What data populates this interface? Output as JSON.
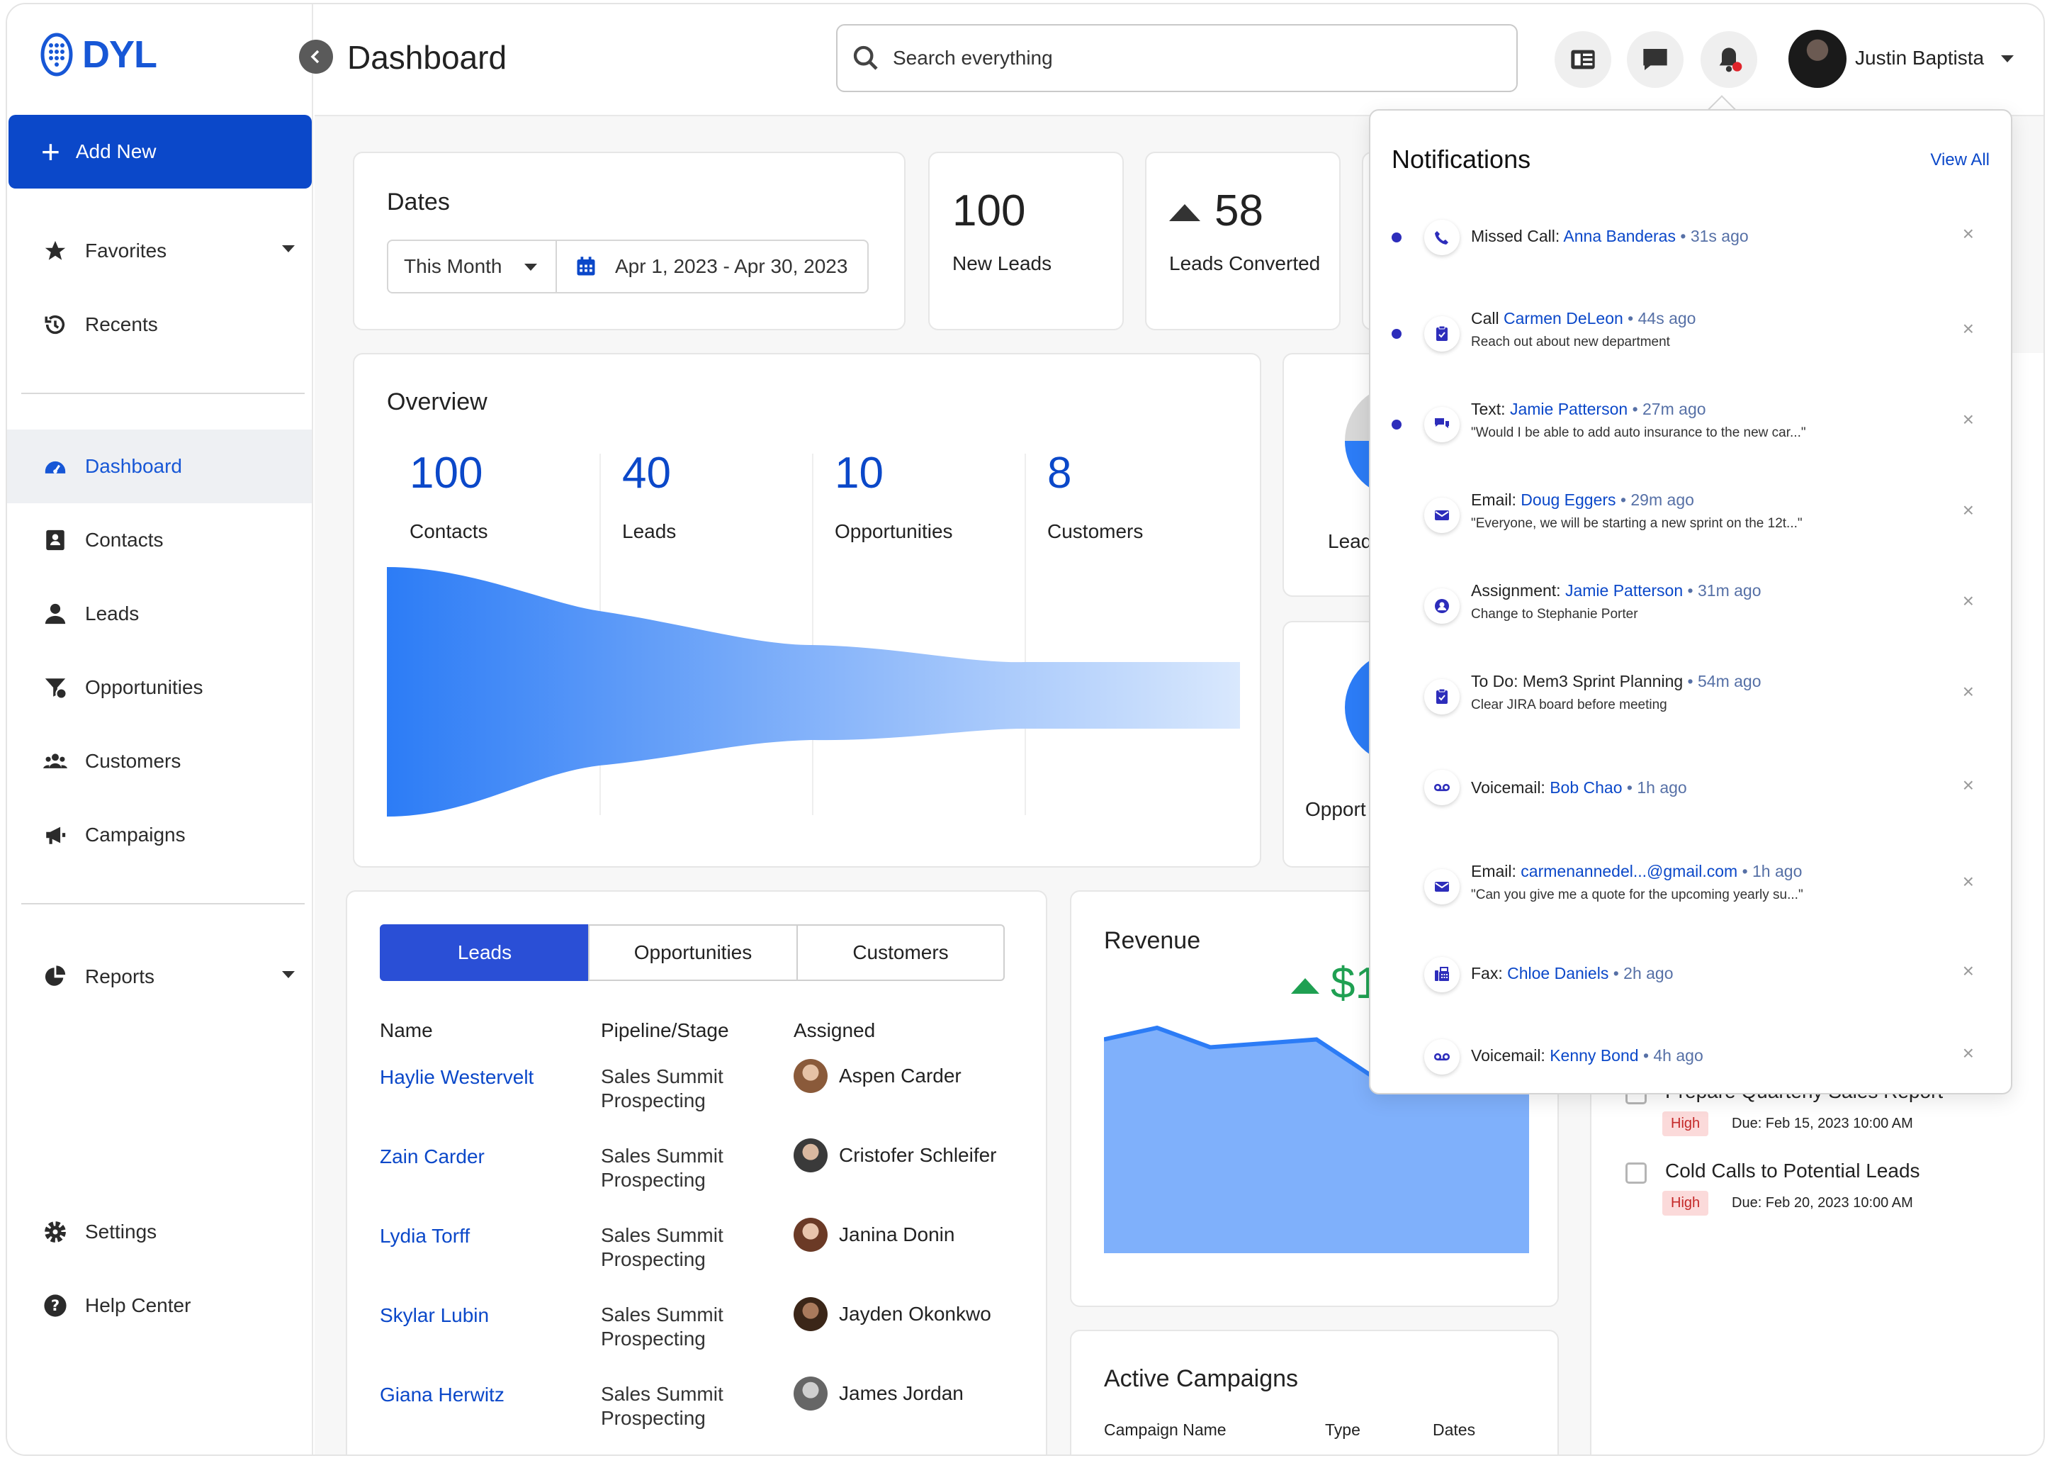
{
  "app": {
    "logo_text": "DYL",
    "page_title": "Dashboard"
  },
  "header": {
    "search_placeholder": "Search everything",
    "user_name": "Justin Baptista",
    "icons": [
      "contacts-book-icon",
      "chat-icon",
      "bell-icon"
    ]
  },
  "sidebar": {
    "add_new": "Add New",
    "items": [
      {
        "label": "Favorites",
        "icon": "star-icon"
      },
      {
        "label": "Recents",
        "icon": "history-icon"
      },
      {
        "label": "Dashboard",
        "icon": "gauge-icon"
      },
      {
        "label": "Contacts",
        "icon": "contact-card-icon"
      },
      {
        "label": "Leads",
        "icon": "person-icon"
      },
      {
        "label": "Opportunities",
        "icon": "funnel-dollar-icon"
      },
      {
        "label": "Customers",
        "icon": "users-icon"
      },
      {
        "label": "Campaigns",
        "icon": "megaphone-icon"
      },
      {
        "label": "Reports",
        "icon": "pie-chart-icon"
      },
      {
        "label": "Settings",
        "icon": "gear-icon"
      },
      {
        "label": "Help Center",
        "icon": "help-icon"
      }
    ]
  },
  "dates": {
    "title": "Dates",
    "range_select": "This Month",
    "range_value": "Apr 1, 2023 - Apr 30, 2023"
  },
  "stats": {
    "new_leads": {
      "value": "100",
      "label": "New Leads"
    },
    "leads_converted": {
      "value": "58",
      "label": "Leads Converted"
    }
  },
  "overview": {
    "title": "Overview",
    "items": [
      {
        "value": "100",
        "label": "Contacts"
      },
      {
        "value": "40",
        "label": "Leads"
      },
      {
        "value": "10",
        "label": "Opportunities"
      },
      {
        "value": "8",
        "label": "Customers"
      }
    ]
  },
  "side_cards": {
    "partial_label_1": "Lead",
    "partial_label_2": "Opport"
  },
  "table": {
    "tabs": [
      "Leads",
      "Opportunities",
      "Customers"
    ],
    "columns": [
      "Name",
      "Pipeline/Stage",
      "Assigned"
    ],
    "rows": [
      {
        "name": "Haylie Westervelt",
        "pipeline": "Sales Summit",
        "stage": "Prospecting",
        "assigned": "Aspen Carder"
      },
      {
        "name": "Zain Carder",
        "pipeline": "Sales Summit",
        "stage": "Prospecting",
        "assigned": "Cristofer Schleifer"
      },
      {
        "name": "Lydia Torff",
        "pipeline": "Sales Summit",
        "stage": "Prospecting",
        "assigned": "Janina Donin"
      },
      {
        "name": "Skylar Lubin",
        "pipeline": "Sales Summit",
        "stage": "Prospecting",
        "assigned": "Jayden Okonkwo"
      },
      {
        "name": "Giana Herwitz",
        "pipeline": "Sales Summit",
        "stage": "Prospecting",
        "assigned": "James Jordan"
      }
    ]
  },
  "revenue": {
    "title": "Revenue",
    "amount_partial": "$1",
    "chart_data": {
      "type": "area",
      "values": [
        84,
        87,
        82,
        83,
        84,
        75,
        79,
        80,
        86
      ]
    }
  },
  "campaigns": {
    "title": "Active Campaigns",
    "columns": [
      "Campaign Name",
      "Type",
      "Dates"
    ]
  },
  "tasks": [
    {
      "title": "Prepare Quarterly Sales Report",
      "priority": "High",
      "due": "Due: Feb 15, 2023 10:00 AM"
    },
    {
      "title": "Cold Calls to Potential Leads",
      "priority": "High",
      "due": "Due: Feb 20, 2023 10:00 AM"
    }
  ],
  "notifications": {
    "title": "Notifications",
    "view_all": "View All",
    "items": [
      {
        "unread": true,
        "icon": "phone-icon",
        "type": "Missed Call:",
        "who": "Anna Banderas",
        "ago": "31s ago",
        "detail": ""
      },
      {
        "unread": true,
        "icon": "clipboard-icon",
        "type": "Call",
        "who": "Carmen DeLeon",
        "ago": "44s ago",
        "detail": "Reach out about new department"
      },
      {
        "unread": true,
        "icon": "text-bubbles-icon",
        "type": "Text:",
        "who": "Jamie Patterson",
        "ago": "27m ago",
        "detail": "\"Would I be able to add auto insurance to the new car...\""
      },
      {
        "unread": false,
        "icon": "envelope-icon",
        "type": "Email:",
        "who": "Doug Eggers",
        "ago": "29m ago",
        "detail": "\"Everyone, we will be starting a new sprint on the 12t...\""
      },
      {
        "unread": false,
        "icon": "person-circle-icon",
        "type": "Assignment:",
        "who": "Jamie Patterson",
        "ago": "31m ago",
        "detail": "Change to Stephanie Porter"
      },
      {
        "unread": false,
        "icon": "clipboard-icon",
        "type": "To Do: Mem3 Sprint Planning",
        "who": "",
        "ago": "54m ago",
        "detail": "Clear JIRA board before meeting"
      },
      {
        "unread": false,
        "icon": "voicemail-icon",
        "type": "Voicemail:",
        "who": "Bob Chao",
        "ago": "1h ago",
        "detail": ""
      },
      {
        "unread": false,
        "icon": "envelope-icon",
        "type": "Email:",
        "who": "carmenannedel...@gmail.com",
        "ago": "1h ago",
        "detail": "\"Can you give me a quote for the upcoming yearly su...\""
      },
      {
        "unread": false,
        "icon": "fax-icon",
        "type": "Fax:",
        "who": "Chloe Daniels",
        "ago": "2h ago",
        "detail": ""
      },
      {
        "unread": false,
        "icon": "voicemail-icon",
        "type": "Voicemail:",
        "who": "Kenny Bond",
        "ago": "4h ago",
        "detail": ""
      }
    ]
  },
  "colors": {
    "brand": "#0b48c9",
    "accent": "#2a4fd6",
    "positive": "#1fa052",
    "funnel": "#2c7cf6",
    "area": "#7fb0fb"
  }
}
